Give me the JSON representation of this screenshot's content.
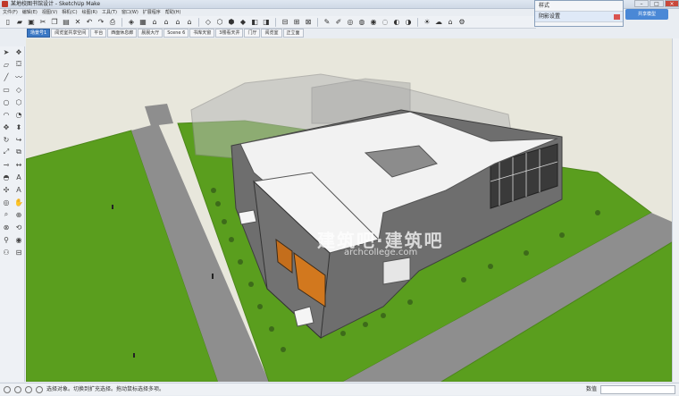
{
  "window": {
    "title": "某地校图书馆设计 - SketchUp Make",
    "badge": "●"
  },
  "menu": [
    "文件(F)",
    "编辑(E)",
    "视图(V)",
    "相机(C)",
    "绘图(R)",
    "工具(T)",
    "窗口(W)",
    "扩展程序",
    "帮助(H)"
  ],
  "scenes": [
    "场景号1",
    "阅览室共享空间",
    "平台",
    "西面休息廊",
    "晨晨大厅",
    "Scene 6",
    "书库天窗",
    "3楼看天井",
    "门厅",
    "阅览室",
    "正立面"
  ],
  "active_scene_index": 0,
  "tray": {
    "row1": "样式",
    "row2": "阴影设置"
  },
  "share_button": "共享模型",
  "status": {
    "message": "选择对象。切换到扩充选择。拖动鼠标选择多项。",
    "measure_label": "数值",
    "measure_value": ""
  },
  "watermark": {
    "text": "建筑吧·建筑吧",
    "sub": "archcollege.com"
  },
  "colors": {
    "grass": "#5a9e1e",
    "road": "#8e8e8e",
    "building_wall": "#6e6e6e",
    "roof": "#f2f2f2",
    "ground": "#e8e7dc"
  }
}
